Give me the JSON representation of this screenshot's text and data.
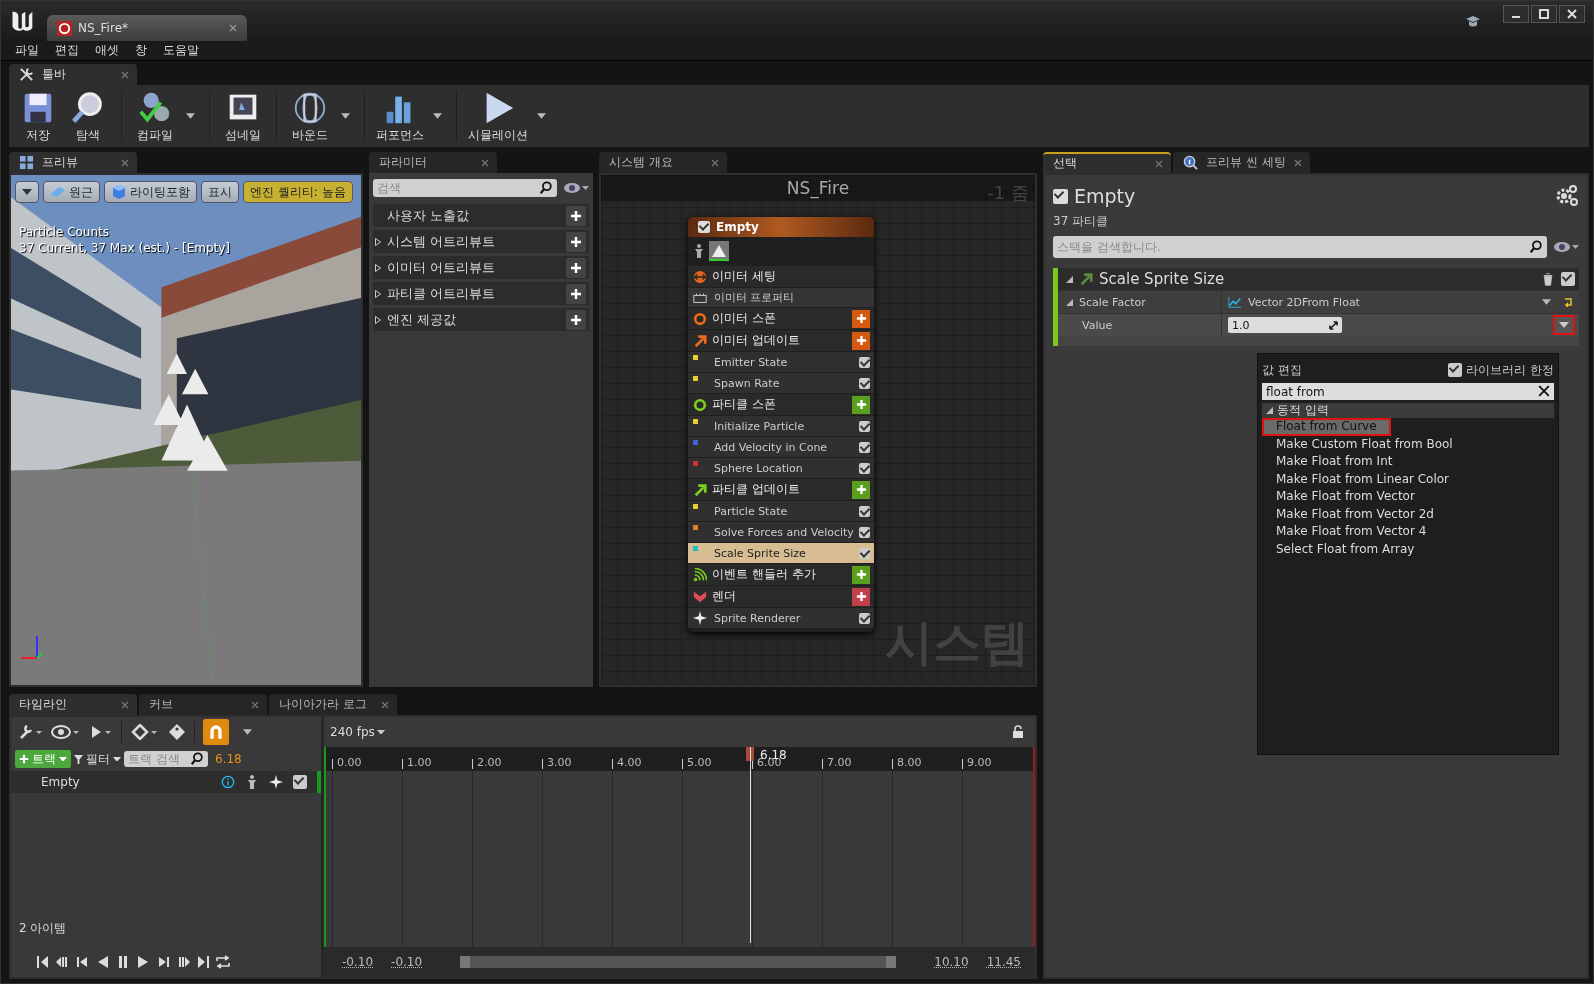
{
  "window": {
    "title": "NS_Fire*"
  },
  "menu": [
    "파일",
    "편집",
    "애셋",
    "창",
    "도움말"
  ],
  "toolbar": {
    "tab": "툴바",
    "groups": [
      [
        {
          "kind": "save",
          "label": "저장",
          "dropdown": false
        },
        {
          "kind": "browse",
          "label": "탐색",
          "dropdown": false
        }
      ],
      [
        {
          "kind": "compile",
          "label": "컴파일",
          "dropdown": true
        }
      ],
      [
        {
          "kind": "thumbnail",
          "label": "섬네일",
          "dropdown": false
        }
      ],
      [
        {
          "kind": "bounds",
          "label": "바운드",
          "dropdown": true
        }
      ],
      [
        {
          "kind": "performance",
          "label": "퍼포먼스",
          "dropdown": true
        }
      ],
      [
        {
          "kind": "simulation",
          "label": "시뮬레이션",
          "dropdown": true
        }
      ]
    ]
  },
  "preview": {
    "tab": "프리뷰",
    "buttons": [
      {
        "kind": "menu"
      },
      {
        "kind": "perspective",
        "label": "원근"
      },
      {
        "kind": "lit",
        "label": "라이팅포함"
      },
      {
        "kind": "show",
        "label": "표시"
      },
      {
        "kind": "quality",
        "label": "엔진 퀄리티: 높음"
      }
    ],
    "stats": [
      "Particle Counts",
      "37 Current, 37 Max (est.) - [Empty]"
    ]
  },
  "parameters": {
    "tab": "파라미터",
    "search": {
      "placeholder": "검색"
    },
    "sections": [
      {
        "label": "사용자 노출값",
        "expandable": false
      },
      {
        "label": "시스템 어트리뷰트",
        "expandable": true
      },
      {
        "label": "이미터 어트리뷰트",
        "expandable": true
      },
      {
        "label": "파티클 어트리뷰트",
        "expandable": true
      },
      {
        "label": "엔진 제공값",
        "expandable": true
      }
    ]
  },
  "system_overview": {
    "tab": "시스템 개요",
    "title": "NS_Fire",
    "zoom": "-1 줌",
    "watermark": "시스템",
    "emitter": {
      "name": "Empty",
      "enabled": true,
      "rows": [
        {
          "kind": "settings",
          "label": "이미터 세팅"
        },
        {
          "kind": "properties",
          "label": "이미터 프로퍼티"
        },
        {
          "kind": "emitter_spawn",
          "label": "이미터 스폰",
          "color": "#d35a10"
        },
        {
          "kind": "emitter_update",
          "label": "이미터 업데이트",
          "color": "#d35a10"
        },
        {
          "kind": "module",
          "label": "Emitter State",
          "color": "#e6d02e",
          "checked": true,
          "selected": false
        },
        {
          "kind": "module",
          "label": "Spawn Rate",
          "color": "#e6d02e",
          "checked": true,
          "selected": false
        },
        {
          "kind": "particle_spawn",
          "label": "파티클 스폰",
          "color": "#5aa01e"
        },
        {
          "kind": "module",
          "label": "Initialize Particle",
          "color": "#e6d02e",
          "checked": true,
          "selected": false
        },
        {
          "kind": "module",
          "label": "Add Velocity in Cone",
          "color": "#4060e0",
          "checked": true,
          "selected": false
        },
        {
          "kind": "module",
          "label": "Sphere Location",
          "color": "#d03030",
          "checked": true,
          "selected": false
        },
        {
          "kind": "particle_update",
          "label": "파티클 업데이트",
          "color": "#5aa01e"
        },
        {
          "kind": "module",
          "label": "Particle State",
          "color": "#e6d02e",
          "checked": true,
          "selected": false
        },
        {
          "kind": "module",
          "label": "Solve Forces and Velocity",
          "color": "#e08020",
          "checked": true,
          "selected": false
        },
        {
          "kind": "module",
          "label": "Scale Sprite Size",
          "color": "#20c0c0",
          "checked": true,
          "selected": true
        },
        {
          "kind": "event",
          "label": "이벤트 핸들러 추가",
          "color": "#5aa01e"
        },
        {
          "kind": "render",
          "label": "렌더",
          "color": "#c0404a"
        },
        {
          "kind": "renderer",
          "label": "Sprite Renderer",
          "checked": true,
          "selected": false
        }
      ]
    }
  },
  "details": {
    "tabs": [
      {
        "label": "선택",
        "selected": true,
        "kind": "plain"
      },
      {
        "label": "프리뷰 씬 세팅",
        "selected": false,
        "kind": "info"
      }
    ],
    "emitter": {
      "name": "Empty",
      "enabled": true,
      "count": "37 파티클"
    },
    "search": {
      "placeholder": "스택을 검색합니다."
    },
    "module": {
      "title": "Scale Sprite Size",
      "expanded": true,
      "enabled": true,
      "input": {
        "label": "Scale Factor",
        "expanded": true,
        "value_type": "Vector 2DFrom Float",
        "children": [
          {
            "label": "Value",
            "value": "1.0"
          }
        ]
      }
    },
    "menu": {
      "title": "값 편집",
      "library_only": {
        "label": "라이브러리 한정",
        "checked": true
      },
      "search": {
        "value": "float from"
      },
      "category": {
        "label": "동적 입력",
        "expanded": true
      },
      "items": [
        {
          "label": "Float from Curve",
          "selected": true
        },
        {
          "label": "Make Custom Float from Bool",
          "selected": false
        },
        {
          "label": "Make Float from Int",
          "selected": false
        },
        {
          "label": "Make Float from Linear Color",
          "selected": false
        },
        {
          "label": "Make Float from Vector",
          "selected": false
        },
        {
          "label": "Make Float from Vector 2d",
          "selected": false
        },
        {
          "label": "Make Float from Vector 4",
          "selected": false
        },
        {
          "label": "Select Float from Array",
          "selected": false
        }
      ]
    }
  },
  "timeline": {
    "tabs": [
      {
        "label": "타임라인",
        "selected": true
      },
      {
        "label": "커브",
        "selected": false
      },
      {
        "label": "나이아가라 로그",
        "selected": false
      }
    ],
    "snap": {
      "on": true
    },
    "fps": "240 fps",
    "add_track": "트랙",
    "filter": "필터",
    "search": {
      "placeholder": "트랙 검색"
    },
    "current_time": "6.18",
    "tracks": [
      {
        "name": "Empty",
        "enabled": true
      }
    ],
    "item_count": "2 아이템",
    "ruler": [
      "0.00",
      "1.00",
      "2.00",
      "3.00",
      "4.00",
      "5.00",
      "6.00",
      "7.00",
      "8.00",
      "9.00"
    ],
    "playhead": "6.18",
    "range": [
      "-0.10",
      "-0.10",
      "10.10",
      "11.45"
    ]
  }
}
